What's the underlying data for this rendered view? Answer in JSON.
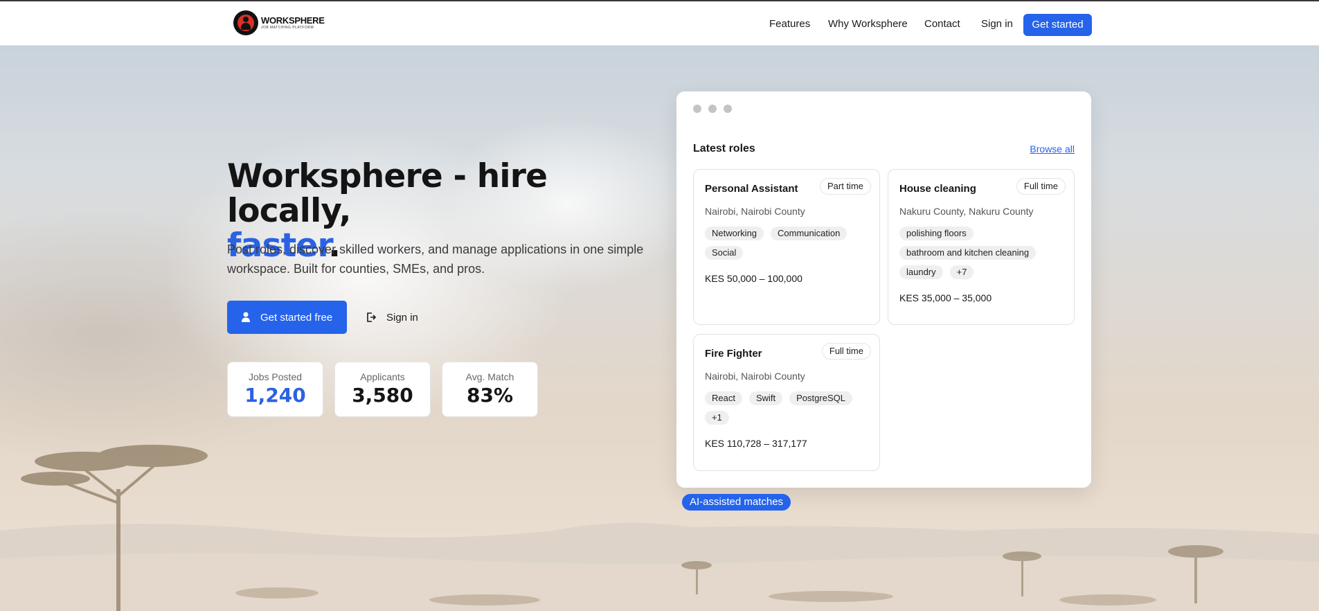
{
  "brand": {
    "name": "WORKSPHERE",
    "tagline": "JOB MATCHING PLATFORM",
    "accent": "#2563eb"
  },
  "nav": {
    "links": [
      "Features",
      "Why Worksphere",
      "Contact",
      "Sign in"
    ],
    "cta": "Get started"
  },
  "hero": {
    "title_main": "Worksphere - hire locally,",
    "title_accent": "faster",
    "title_end": ".",
    "subtitle": "Post roles, discover skilled workers, and manage applications in one simple workspace. Built for counties, SMEs, and pros.",
    "primary_button": "Get started free",
    "secondary_button": "Sign in",
    "stats": [
      {
        "label": "Jobs Posted",
        "value": "1,240"
      },
      {
        "label": "Applicants",
        "value": "3,580"
      },
      {
        "label": "Avg. Match",
        "value": "83%"
      }
    ]
  },
  "preview": {
    "title": "Latest roles",
    "browse_label": "Browse all",
    "jobs": [
      {
        "title": "Personal Assistant",
        "type": "Part time",
        "location": "Nairobi, Nairobi County",
        "tags": [
          "Networking",
          "Communication",
          "Social"
        ],
        "pay": "KES 50,000 – 100,000"
      },
      {
        "title": "House cleaning",
        "type": "Full time",
        "location": "Nakuru County, Nakuru County",
        "tags": [
          "polishing floors",
          "bathroom and kitchen cleaning",
          "laundry",
          "+7"
        ],
        "pay": "KES 35,000 – 35,000"
      },
      {
        "title": "Fire Fighter",
        "type": "Full time",
        "location": "Nairobi, Nairobi County",
        "tags": [
          "React",
          "Swift",
          "PostgreSQL",
          "+1"
        ],
        "pay": "KES 110,728 – 317,177"
      }
    ],
    "badge": "AI-assisted matches"
  }
}
